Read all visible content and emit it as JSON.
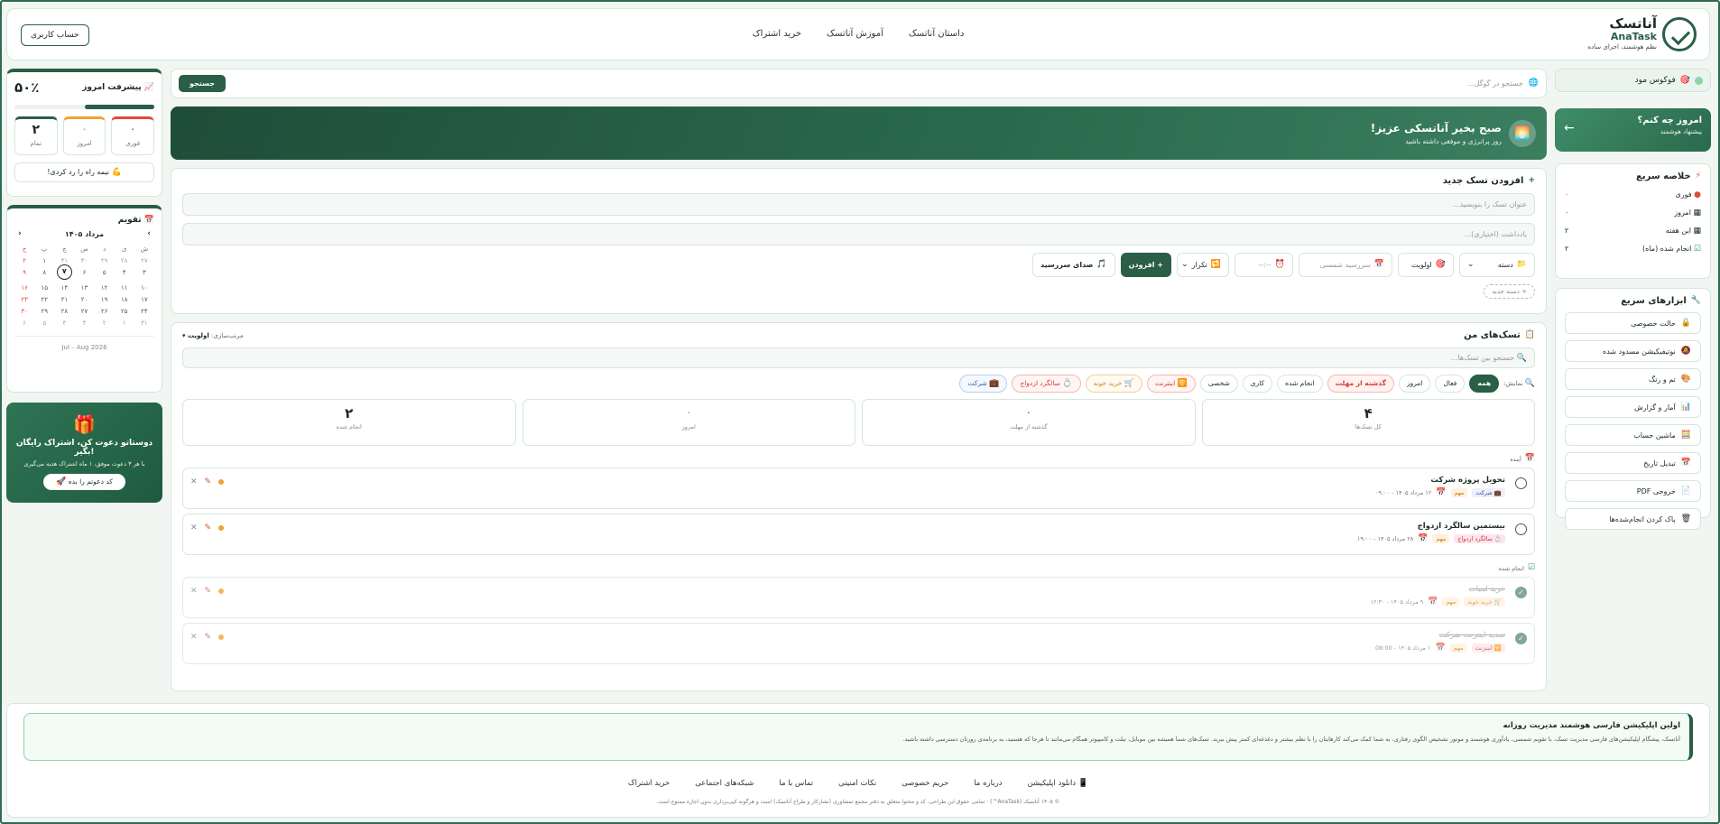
{
  "header": {
    "logo_fa": "آناتسک",
    "logo_en": "AnaTask",
    "tagline": "نظم هوشمند، اجرای ساده",
    "nav": [
      "داستان آناتسک",
      "آموزش آناتسک",
      "خرید اشتراک"
    ],
    "account_button": "حساب کاربری"
  },
  "right": {
    "focus_label": "فوکوس مود",
    "what_todo_title": "امروز چه کنم؟",
    "what_todo_sub": "پیشنهاد هوشمند",
    "summary_title": "خلاصه سریع",
    "summary": [
      {
        "label": "فوری",
        "value": "۰"
      },
      {
        "label": "امروز",
        "value": "۰"
      },
      {
        "label": "این هفته",
        "value": "۲"
      },
      {
        "label": "انجام شده (ماه)",
        "value": "۲"
      }
    ],
    "tools_title": "ابزارهای سریع",
    "tools": [
      "حالت خصوصی",
      "نوتیفیکیشن مسدود شده",
      "تم و رنگ",
      "آمار و گزارش",
      "ماشین حساب",
      "تبدیل تاریخ",
      "خروجی PDF",
      "پاک کردن انجام‌شده‌ها"
    ]
  },
  "left": {
    "progress_title": "پیشرفت امروز",
    "progress_pct": "۵۰٪",
    "progress_value": 0.5,
    "stats": [
      {
        "num": "۰",
        "label": "فوری",
        "color": "#e04a3a"
      },
      {
        "num": "۰",
        "label": "امروز",
        "color": "#f0a22e"
      },
      {
        "num": "۲",
        "label": "تمام",
        "color": "#2a5e46"
      }
    ],
    "halfway": "نیمه راه را رد کردی!",
    "calendar_title": "تقویم",
    "calendar_month": "مرداد ۱۴۰۵",
    "weekdays": [
      "ش",
      "ی",
      "د",
      "س",
      "چ",
      "پ",
      "ج"
    ],
    "days": [
      "۲۷",
      "۲۸",
      "۲۹",
      "۳۰",
      "۳۱",
      "۱",
      "۲",
      "۳",
      "۴",
      "۵",
      "۶",
      "۷",
      "۸",
      "۹",
      "۱۰",
      "۱۱",
      "۱۲",
      "۱۳",
      "۱۴",
      "۱۵",
      "۱۶",
      "۱۷",
      "۱۸",
      "۱۹",
      "۲۰",
      "۲۱",
      "۲۲",
      "۲۳",
      "۲۴",
      "۲۵",
      "۲۶",
      "۲۷",
      "۲۸",
      "۲۹",
      "۳۰",
      "۳۱",
      "۱",
      "۲",
      "۳",
      "۴",
      "۵",
      "۶"
    ],
    "calendar_foot": "Jul – Aug 2026",
    "invite_title": "دوستاتو دعوت کن، اشتراک رایگان بگیر!",
    "invite_sub": "با هر ۳ دعوت موفق، ۱ ماه اشتراک هدیه می‌گیری",
    "invite_button": "کد دعوتم را بده"
  },
  "center": {
    "search_placeholder": "جستجو در گوگل...",
    "search_button": "جستجو",
    "hero_title": "صبح بخیر آناتسکی عزیز!",
    "hero_sub": "روز پرانرژی و موفقی داشته باشید",
    "newtask_title": "افزودن تسک جدید",
    "title_placeholder": "عنوان تسک را بنویسید...",
    "note_placeholder": "یادداشت (اختیاری)...",
    "ctrl_category": "دسته",
    "ctrl_priority": "اولویت",
    "ctrl_due": "سررسید شمسی",
    "ctrl_time": "--:--",
    "ctrl_repeat": "تکرار",
    "add_button": "+ افزودن",
    "ctrl_sound": "صدای سررسید",
    "new_category": "+ دسته جدید",
    "mytasks_title": "تسک‌های من",
    "sort_label": "مرتب‌سازی:",
    "sort_value": "اولویت ▾",
    "tasks_search": "جستجو بین تسک‌ها...",
    "filter_label": "نمایش:",
    "filters": [
      "همه",
      "فعال",
      "امروز",
      "گذشته از مهلت",
      "انجام شده",
      "کاری",
      "شخصی",
      "اینترنت",
      "خرید خونه",
      "سالگرد ازدواج",
      "شرکت"
    ],
    "stats": [
      {
        "num": "۴",
        "label": "کل تسک‌ها"
      },
      {
        "num": "۰",
        "label": "گذشته از مهلت"
      },
      {
        "num": "۰",
        "label": "امروز"
      },
      {
        "num": "۲",
        "label": "انجام شده"
      }
    ],
    "upcoming_label": "آینده",
    "done_label": "انجام شده",
    "tasks": [
      {
        "title": "تحویل پروژه شرکت",
        "tag": "شرکت",
        "imp": "مهم",
        "date": "۱۲ مرداد ۱۴۰۵ - ۰۹:۰۰"
      },
      {
        "title": "بیستمین سالگرد ازدواج",
        "tag": "سالگرد ازدواج",
        "imp": "مهم",
        "date": "۲۸ مرداد ۱۴۰۵ - ۱۹:۰۰"
      }
    ],
    "done_tasks": [
      {
        "title": "خرید لبنیات",
        "tag": "خرید خونه",
        "imp": "مهم",
        "date": "۹ مرداد ۱۴۰۵ - ۱۲:۳۰"
      },
      {
        "title": "تمدید اینترنت شرکت",
        "tag": "اینترنت",
        "imp": "مهم",
        "date": "۱ مرداد ۱۴۰۵ - 08:00"
      }
    ]
  },
  "footer": {
    "about_title": "اولین اپلیکیشن فارسی هوشمند مدیریت روزانه",
    "about_text": "آناتسک، پیشگام اپلیکیشن‌های فارسی مدیریت تسک، با تقویم شمسی، یادآوری هوشمند و موتور تشخیص الگوی رفتاری، به شما کمک می‌کند کارهایتان را با نظم بیشتر و دغدغه‌ای کمتر پیش ببرید. تسک‌های شما همیشه بین موبایل، تبلت و کامپیوتر همگام می‌مانند تا هرجا که هستید، به برنامه‌ی روزتان دسترسی داشته باشید.",
    "links": [
      "دانلود اپلیکیشن",
      "درباره ما",
      "حریم خصوصی",
      "نکات امنیتی",
      "تماس با ما",
      "شبکه‌های اجتماعی",
      "خرید اشتراک"
    ],
    "copyright": "© ۱۴۰۵ آناتسک (AnaTask™) · تمامی حقوق این طراحی، کد و محتوا متعلق به دفتر مجمع تمشاوری (نشارکار و طراح آناتسک) است و هرگونه کپی‌برداری بدون اجازه ممنوع است."
  }
}
